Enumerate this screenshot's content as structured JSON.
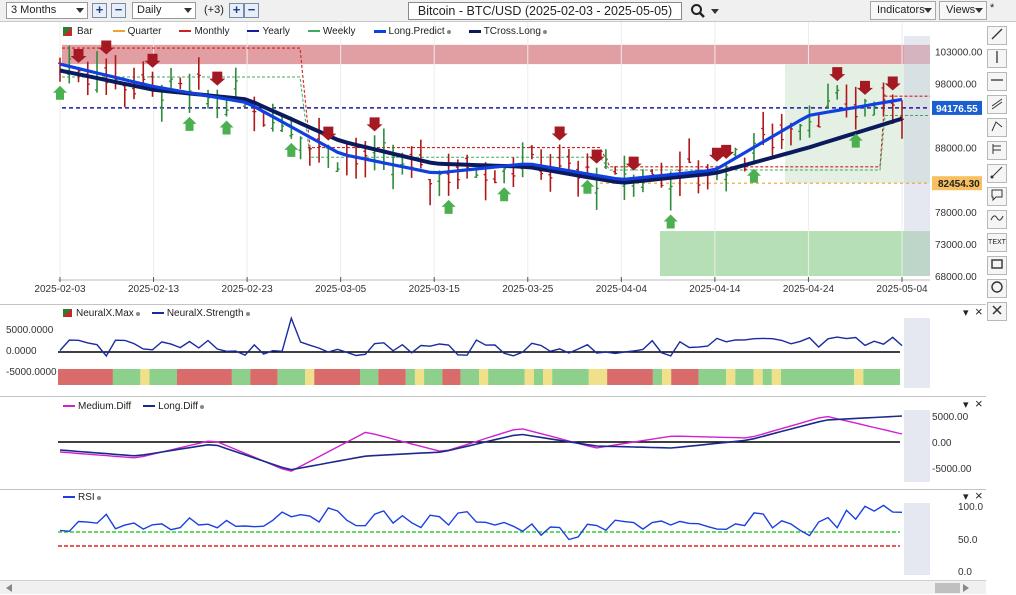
{
  "toolbar": {
    "range": "3 Months",
    "plus": "+",
    "minus": "−",
    "interval": "Daily",
    "count": "(+3)",
    "plus2": "+",
    "minus2": "−",
    "title": "Bitcoin - BTC/USD (2025-02-03 - 2025-05-05)",
    "indicators": "Indicators",
    "views": "Views",
    "star": "*"
  },
  "main_legend": [
    {
      "label": "Bar",
      "color": "#2e7d32"
    },
    {
      "label": "Quarter",
      "color": "#f0a030"
    },
    {
      "label": "Monthly",
      "color": "#d02020"
    },
    {
      "label": "Yearly",
      "color": "#1a1aa0"
    },
    {
      "label": "Weekly",
      "color": "#40a860"
    },
    {
      "label": "Long.Predict",
      "color": "#1040e0"
    },
    {
      "label": "TCross.Long",
      "color": "#0a1a5c"
    }
  ],
  "price_axis": {
    "ticks": [
      "103000.00",
      "98000.00",
      "88000.00",
      "78000.00",
      "73000.00",
      "68000.00"
    ],
    "min": 68000,
    "max": 106000
  },
  "price_labels": {
    "yearly": "94176.55",
    "quarter": "82454.30"
  },
  "date_axis": [
    "2025-02-03",
    "2025-02-13",
    "2025-02-23",
    "2025-03-05",
    "2025-03-15",
    "2025-03-25",
    "2025-04-04",
    "2025-04-14",
    "2025-04-24",
    "2025-05-04"
  ],
  "neural_panel": {
    "legend": [
      "NeuralX.Max",
      "NeuralX.Strength"
    ],
    "ticks": [
      "5000.0000",
      "0.0000",
      "-5000.0000"
    ]
  },
  "diff_panel": {
    "legend": [
      "Medium.Diff",
      "Long.Diff"
    ],
    "ticks": [
      "5000.00",
      "0.00",
      "-5000.00"
    ]
  },
  "rsi_panel": {
    "legend": [
      "RSI"
    ],
    "ticks": [
      "100.0",
      "50.0",
      "0.0"
    ]
  },
  "panel_controls": {
    "arrow": "▾",
    "close": "×"
  },
  "chart_data": {
    "type": "line",
    "title": "Bitcoin - BTC/USD (2025-02-03 - 2025-05-05)",
    "x": [
      "2025-02-03",
      "2025-02-13",
      "2025-02-23",
      "2025-03-05",
      "2025-03-15",
      "2025-03-25",
      "2025-04-04",
      "2025-04-14",
      "2025-04-24",
      "2025-05-04"
    ],
    "series": [
      {
        "name": "Long.Predict",
        "values": [
          101000,
          97500,
          95000,
          87000,
          84000,
          85500,
          83000,
          84500,
          93000,
          95500
        ]
      },
      {
        "name": "TCross.Long",
        "values": [
          100000,
          97000,
          95500,
          89000,
          85500,
          85000,
          82500,
          84000,
          88000,
          92500
        ]
      }
    ],
    "yearly_level": 94176.55,
    "quarter_level": 82454.3,
    "ylim": [
      68000,
      106000
    ],
    "colors": {
      "up": "#2e8b3a",
      "down": "#b01818",
      "predict": "#1040e0",
      "tcross": "#0a1a5c",
      "rsi": "#1a40e0",
      "medium_diff": "#d020d0",
      "long_diff": "#1a2a8a"
    }
  }
}
